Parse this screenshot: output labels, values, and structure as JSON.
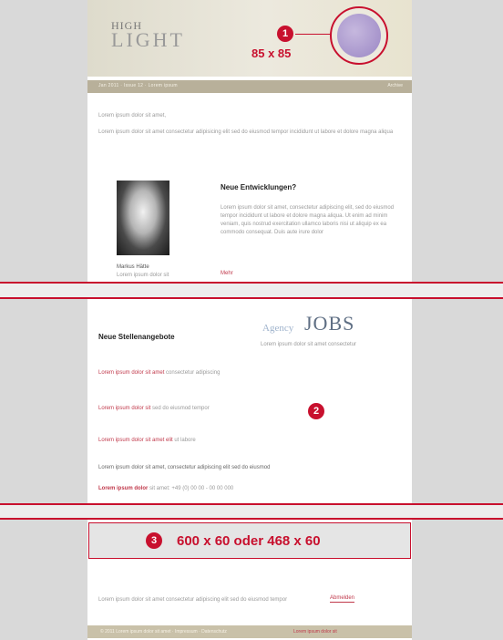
{
  "colors": {
    "accent": "#c8102e",
    "header_bg": "#ece9de",
    "nav_bg": "#b8b09a"
  },
  "header": {
    "logo_top": "HIGH",
    "logo_bottom": "LIGHT",
    "avatar_icon": "avatar-icon",
    "size_label": "85 x 85",
    "badge": "1"
  },
  "navbar": {
    "left": "Jan 2011 · Issue 12 · Lorem ipsum",
    "right": "Archive"
  },
  "intro": {
    "greeting": "Lorem ipsum dolor sit amet,",
    "text": "Lorem ipsum dolor sit amet consectetur adipisicing elit sed do eiusmod tempor incididunt ut labore et dolore magna aliqua"
  },
  "article": {
    "title": "Neue Entwicklungen?",
    "body": "Lorem ipsum dolor sit amet, consectetur adipiscing elit, sed do eiusmod tempor incididunt ut labore et dolore magna aliqua. Ut enim ad minim veniam, quis nostrud exercitation ullamco laboris nisi ut aliquip ex ea commodo consequat. Duis aute irure dolor",
    "link": "Mehr",
    "caption_name": "Markus Hätte",
    "caption_role": "Lorem ipsum dolor sit"
  },
  "jobs": {
    "title": "Neue Stellenangebote",
    "logo_small": "Agency",
    "logo_big": "JOBS",
    "subtitle": "Lorem ipsum dolor sit amet consectetur",
    "badge": "2",
    "items": [
      {
        "link": "Lorem ipsum dolor sit amet",
        "rest": "consectetur adipiscing"
      },
      {
        "link": "Lorem ipsum dolor sit",
        "rest": "sed do eiusmod tempor"
      },
      {
        "link": "Lorem ipsum dolor sit amet elit",
        "rest": "ut labore"
      }
    ],
    "note": "Lorem ipsum dolor sit amet, consectetur adipiscing elit sed do eiusmod",
    "contact_bold": "Lorem ipsum dolor",
    "contact_rest": "sit amet: +49 (0) 00 00 - 00 00 000"
  },
  "banner": {
    "badge": "3",
    "label": "600 x 60 oder 468 x 60"
  },
  "footer_note": {
    "text": "Lorem ipsum dolor sit amet consectetur adipiscing elit sed do eiusmod tempor",
    "button": "Abmelden"
  },
  "footer": {
    "text": "© 2011 Lorem ipsum dolor sit amet · Impressum · Datenschutz",
    "link": "Lorem ipsum dolor sit"
  }
}
